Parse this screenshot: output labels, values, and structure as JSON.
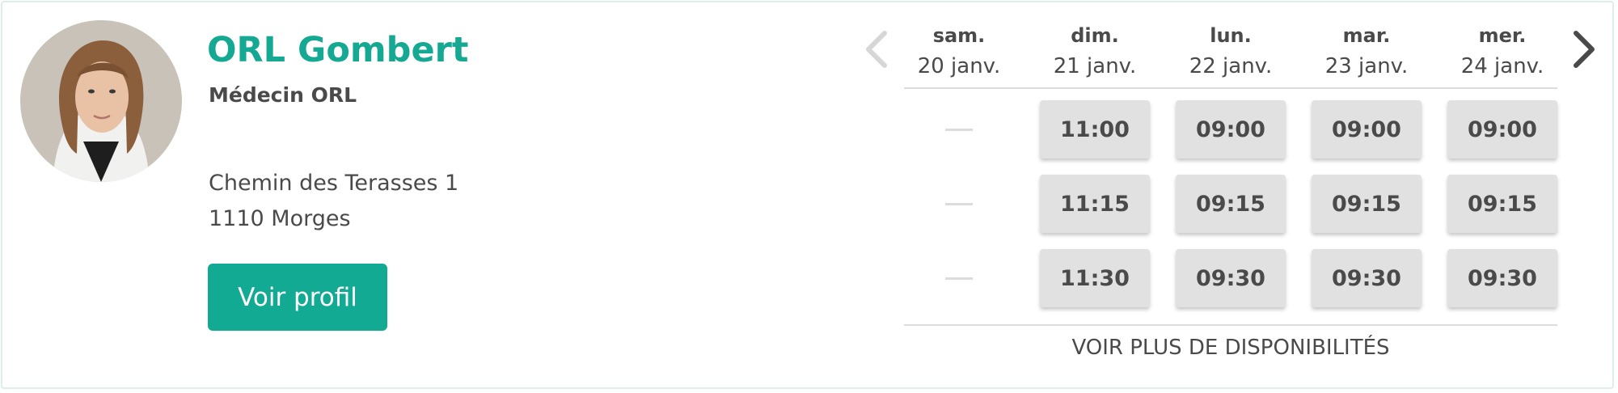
{
  "doctor": {
    "name": "ORL Gombert",
    "specialty": "Médecin ORL",
    "address_line1": "Chemin des Terasses 1",
    "address_line2": "1110 Morges",
    "profile_button": "Voir profil"
  },
  "calendar": {
    "days": [
      {
        "day": "sam.",
        "date": "20 janv.",
        "slots": [
          "",
          "",
          ""
        ]
      },
      {
        "day": "dim.",
        "date": "21 janv.",
        "slots": [
          "11:00",
          "11:15",
          "11:30"
        ]
      },
      {
        "day": "lun.",
        "date": "22 janv.",
        "slots": [
          "09:00",
          "09:15",
          "09:30"
        ]
      },
      {
        "day": "mar.",
        "date": "23 janv.",
        "slots": [
          "09:00",
          "09:15",
          "09:30"
        ]
      },
      {
        "day": "mer.",
        "date": "24 janv.",
        "slots": [
          "09:00",
          "09:15",
          "09:30"
        ]
      }
    ],
    "more_label": "VOIR PLUS DE DISPONIBILITÉS"
  },
  "icons": {
    "prev": "chevron-left-icon",
    "next": "chevron-right-icon"
  },
  "colors": {
    "accent": "#15a892",
    "button": "#13aa94",
    "slot_bg": "#e1e1e1"
  }
}
